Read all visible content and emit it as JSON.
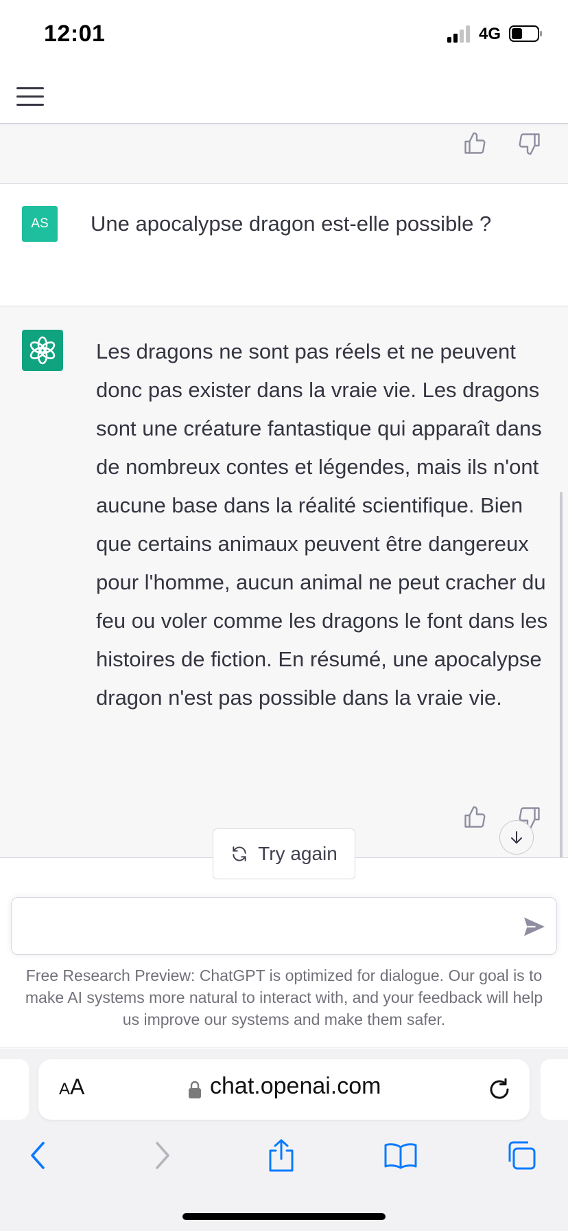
{
  "status_bar": {
    "time": "12:01",
    "network": "4G"
  },
  "header": {
    "menu_icon": "hamburger-menu-icon"
  },
  "conversation": {
    "user": {
      "avatar_initials": "AS",
      "message": "Une apocalypse dragon est-elle possible ?"
    },
    "assistant": {
      "avatar_icon": "openai-logo-icon",
      "message": "Les dragons ne sont pas réels et ne peuvent donc pas exister dans la vraie vie. Les dragons sont une créature fantastique qui apparaît dans de nombreux contes et légendes, mais ils n'ont aucune base dans la réalité scientifique. Bien que certains animaux peuvent être dangereux pour l'homme, aucun animal ne peut cracher du feu ou voler comme les dragons le font dans les histoires de fiction. En résumé, une apocalypse dragon n'est pas possible dans la vraie vie."
    }
  },
  "actions": {
    "try_again_label": "Try again"
  },
  "composer": {
    "input_value": "",
    "input_placeholder": ""
  },
  "footer": {
    "disclaimer": "Free Research Preview: ChatGPT is optimized for dialogue. Our goal is to make AI systems more natural to interact with, and your feedback will help us improve our systems and make them safer."
  },
  "browser": {
    "aa_small": "A",
    "aa_large": "A",
    "url": "chat.openai.com"
  },
  "colors": {
    "user_avatar": "#1ebf9e",
    "assistant_avatar": "#10a37f",
    "assistant_bg": "#f7f7f8",
    "browser_blue": "#0a7aff"
  }
}
